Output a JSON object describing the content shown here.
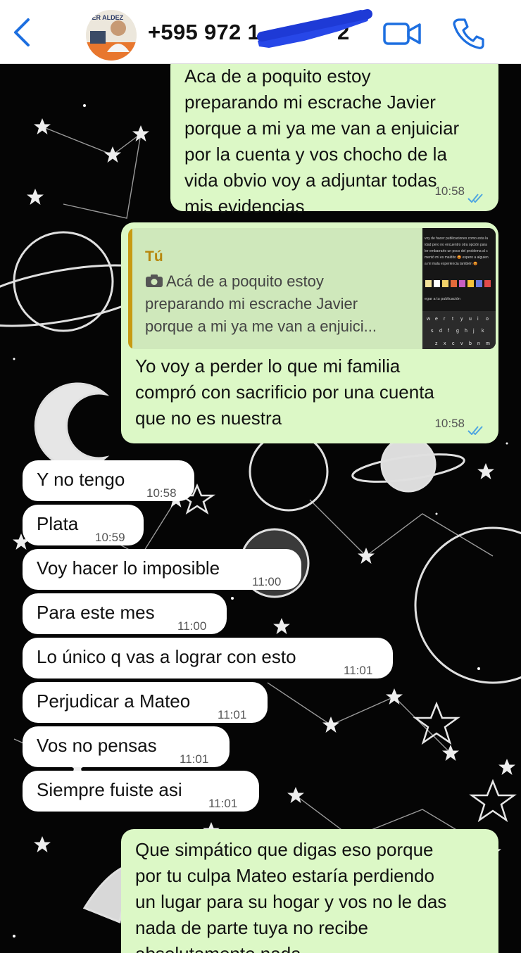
{
  "header": {
    "contact_name": "+595 972 1",
    "contact_name_tail": "2",
    "avatar_text": "IER ALDEZ"
  },
  "messages": [
    {
      "dir": "out",
      "text": "Aca de a poquito estoy\npreparando mi escrache Javier\nporque a mi ya me van a enjuiciar\npor la cuenta y vos chocho de la\nvida obvio voy a adjuntar todas\nmis evidencias",
      "time": "10:58"
    },
    {
      "dir": "out",
      "text": "Yo voy a perder lo que mi familia\ncompró con sacrificio por una cuenta\nque no es nuestra",
      "time": "10:58",
      "quote": {
        "author": "Tú",
        "text": "Acá de a poquito estoy\npreparando mi escrache Javier\nporque a mi ya me van a enjuici..."
      }
    },
    {
      "dir": "in",
      "text": "Y no tengo",
      "time": "10:58"
    },
    {
      "dir": "in",
      "text": "Plata",
      "time": "10:59"
    },
    {
      "dir": "in",
      "text": "Voy hacer lo imposible",
      "time": "11:00"
    },
    {
      "dir": "in",
      "text": "Para este mes",
      "time": "11:00"
    },
    {
      "dir": "in",
      "text": "Lo único q vas a lograr con esto",
      "time": "11:01"
    },
    {
      "dir": "in",
      "text": "Perjudicar a Mateo",
      "time": "11:01"
    },
    {
      "dir": "in",
      "text": "Vos no pensas",
      "time": "11:01"
    },
    {
      "dir": "in",
      "text": "Siempre fuiste asi",
      "time": "11:01"
    },
    {
      "dir": "out",
      "text": "Que simpático que digas eso porque\npor tu culpa Mateo estaría perdiendo\nun lugar para su hogar y vos no le das\nnada de parte tuya no recibe\nabsolutamente nada"
    }
  ],
  "quote_thumbnail": {
    "text_lines": [
      "voy de hacer publicaciones como esta la",
      "idad pero no encuentro otra opción para",
      "ler embarrarle un poco del problema al c",
      "mentó mi es maldito 😡 espero a alguien",
      "a mi mala experiencia también 😡"
    ],
    "keyboard_row1": [
      "w",
      "e",
      "r",
      "t",
      "y",
      "u",
      "i",
      "o"
    ],
    "keyboard_row2": [
      "s",
      "d",
      "f",
      "g",
      "h",
      "j",
      "k"
    ],
    "keyboard_row3": [
      "z",
      "x",
      "c",
      "v",
      "b",
      "n",
      "m"
    ],
    "reply_hint": "egar a tu publicación"
  },
  "colors": {
    "outgoing_bubble": "#dcf8c6",
    "incoming_bubble": "#ffffff",
    "quote_author": "#b7870d",
    "read_ticks": "#4fa6e0",
    "header_icons": "#1d6fe0"
  }
}
